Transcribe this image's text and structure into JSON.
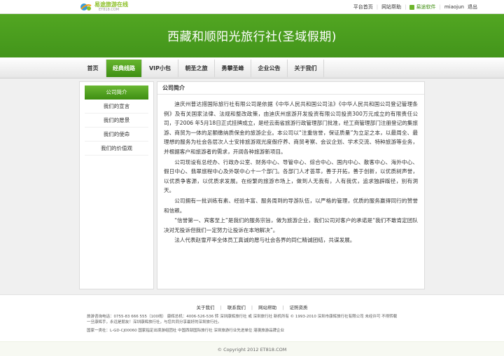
{
  "header": {
    "logo_text": "易途旅游在线",
    "logo_sub": "ET818.COM",
    "links": [
      "平台首页",
      "网站帮助"
    ],
    "download_label": "易途软件",
    "username": "miaojun",
    "logout_label": "退出"
  },
  "banner": {
    "title": "西藏和顺阳光旅行社(圣域假期)"
  },
  "nav": {
    "items": [
      {
        "label": "首页"
      },
      {
        "label": "经典线路"
      },
      {
        "label": "VIP小包"
      },
      {
        "label": "朝圣之旅"
      },
      {
        "label": "勇攀圣峰"
      },
      {
        "label": "企业公告"
      },
      {
        "label": "关于我们"
      }
    ],
    "active_index": 1
  },
  "sidebar": {
    "items": [
      {
        "label": "公司简介"
      },
      {
        "label": "我们的宣言"
      },
      {
        "label": "我们的愿景"
      },
      {
        "label": "我们的使命"
      },
      {
        "label": "我们的价值观"
      }
    ],
    "active_index": 0
  },
  "content": {
    "heading": "公司简介",
    "paragraphs": [
      "迪庆州普达措国际旅行社有限公司是依据《中华人民共和国公司法》《中华人民共和国公司登记管理条例》及有关国家法律、法规和整改政策，由迪庆州旅游开发投资有限公司投资300万元成立的有限责任公司，于2006 年5月18日正式挂牌成立，是经云南省旅游行政管理部门批准，经工商管理部门注册登记的集旅游、商贸为一体的足额缴纳质保金的旅游企业。本公司以“注重信誉，保证质量”为立足之本，以最周全、最理想的服务为社会各层次人士安排旅游观光度假疗养、商贸考察、会议企划、学术交流、特种旅游等业务，并根据客户和旅游者的需求，开阔各种旅游新项目。",
      "公司现设有总经办、行政办公室、财务中心、导管中心、综合中心、国内中心、散客中心、海外中心、假日中心、翡翠旅程中心及外联中心十一个部门。各部门人才荟萃，善于开拓，善于创新，以优质树声誉，以优质争客源，以优质求发展。在纷繁的旅游市场上，做到人无我有，人有我优，追求独辟蹊径，别有洞天。",
      "公司拥有一批训练有素、经验丰富、服务周到的导游队伍，以严格的管理，优质的服务赢得同行的赞誉和信赖。",
      "“信誉第一、宾客至上”是我们的服务宗旨，做为旅游企业，我们公司对客户的承诺是“我们不敢肯定团队决对无投诉但我们一定努力让投诉在本地解决”。",
      "法人代表赵雪芹率全体员工真诚的愿与社会各界的同仁精诚团结，共谋发展。"
    ]
  },
  "footer": {
    "links": [
      "关于我们",
      "联系我们",
      "网站帮助",
      "证照资质"
    ],
    "line1": "旅游咨询电话：0755-83 666 555（100线） 康辉总机：4006-526-536 转 深圳康辉旅行社 或 深圳旅行社 新机所有 © 1993-2010 深圳市康辉旅行社有限公司 未经许可 不得转载",
    "line2": "一旦康辉手，永远是朋友！深圳康辉旅行社，与您共同分享最好的深圳旅行社。",
    "line3": "国家一类社：L-GD-CJ00060 国家指定出境游组团社 中国西部国际旅行社 深圳旅游行业先进单位 港澳旅游品牌企业",
    "copyright": "© Copyright 2012 ET818.COM"
  },
  "colors": {
    "brand_green": "#4ea21f",
    "active_green": "#5aa826",
    "background": "#f0f0f0"
  }
}
